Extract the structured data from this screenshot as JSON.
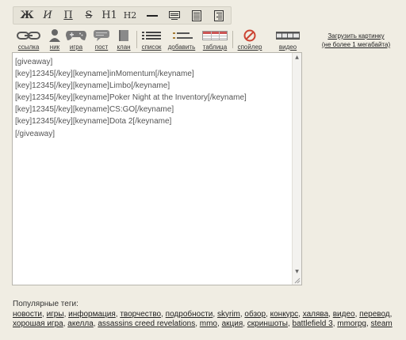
{
  "format_toolbar": [
    {
      "id": "bold",
      "glyph": "Ж"
    },
    {
      "id": "italic",
      "glyph": "И"
    },
    {
      "id": "underline",
      "glyph": "П"
    },
    {
      "id": "strike",
      "glyph": "S"
    },
    {
      "id": "h1",
      "glyph": "H1"
    },
    {
      "id": "h2",
      "glyph": "H2"
    },
    {
      "id": "hr",
      "glyph": "—"
    },
    {
      "id": "quote",
      "glyph": ""
    },
    {
      "id": "justify",
      "glyph": ""
    },
    {
      "id": "align-right",
      "glyph": ""
    }
  ],
  "insert_toolbar": {
    "link": "ссылка",
    "nick": "ник",
    "game": "игра",
    "post": "пост",
    "clan": "клан",
    "list": "список",
    "add": "добавить",
    "table": "таблица",
    "spoiler": "спойлер",
    "video": "видео"
  },
  "upload": {
    "line1": "Загрузить картинку",
    "line2": "(не более 1 мегабайта)"
  },
  "editor": {
    "text": "[giveaway]\n[key]12345[/key][keyname]inMomentum[/keyname]\n[key]12345[/key][keyname]Limbo[/keyname]\n[key]12345[/key][keyname]Poker Night at the Inventory[/keyname]\n[key]12345[/key][keyname]CS:GO[/keyname]\n[key]12345[/key][keyname]Dota 2[/keyname]\n[/giveaway]"
  },
  "popular_tags": {
    "title": "Популярные теги:",
    "tags": [
      "новости",
      "игры",
      "информация",
      "творчество",
      "подробности",
      "skyrim",
      "обзор",
      "конкурс",
      "халява",
      "видео",
      "перевод",
      "хорошая игра",
      "акелла",
      "assassins creed revelations",
      "mmo",
      "акция",
      "скриншоты",
      "battlefield 3",
      "mmorpg",
      "steam"
    ]
  },
  "colors": {
    "background": "#f0ede3",
    "toolbar": "#e6e3d8",
    "editor_border": "#b7b5ad",
    "editor_text": "#555555"
  }
}
